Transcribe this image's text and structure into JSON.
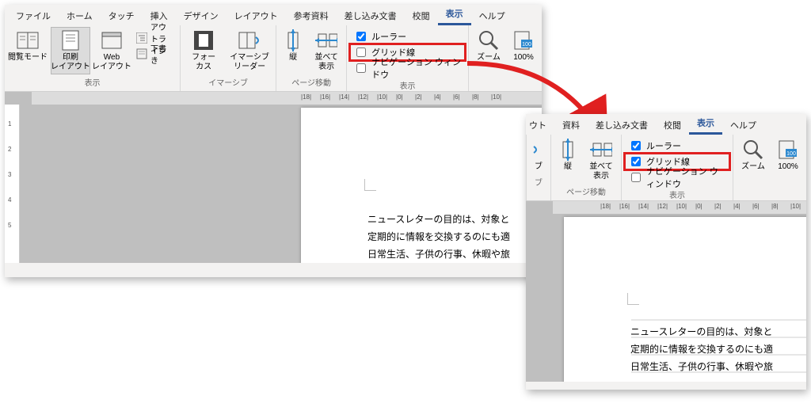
{
  "tabs": {
    "file": "ファイル",
    "home": "ホーム",
    "touch": "タッチ",
    "insert": "挿入",
    "design": "デザイン",
    "layout": "レイアウト",
    "ref": "参考資料",
    "mail": "差し込み文書",
    "review": "校閲",
    "view": "表示",
    "help": "ヘルプ"
  },
  "ribbon": {
    "views_group": "表示",
    "read_mode": "閲覧モード",
    "print_layout": "印刷\nレイアウト",
    "web_layout": "Web\nレイアウト",
    "outline": "アウトライン",
    "draft": "下書き",
    "immersive_group": "イマーシブ",
    "focus": "フォー\nカス",
    "immersive_reader": "イマーシブ\nリーダー",
    "pagemove_group": "ページ移動",
    "vertical": "縦",
    "sidebyside": "並べて\n表示",
    "show_group": "表示",
    "ruler": "ルーラー",
    "grid": "グリッド線",
    "nav": "ナビゲーション ウィンドウ",
    "zoom_group": "ズーム",
    "zoom": "ズーム",
    "p100": "100%"
  },
  "doc": {
    "line1": "ニュースレターの目的は、対象と",
    "line2": "定期的に情報を交換するのにも適",
    "line3": "日常生活、子供の行事、休暇や旅"
  },
  "ruler_h": [
    -18,
    -16,
    -14,
    -12,
    -10,
    0,
    2,
    4,
    6,
    8,
    10
  ],
  "ruler_v": [
    1,
    2,
    3,
    4,
    5
  ]
}
